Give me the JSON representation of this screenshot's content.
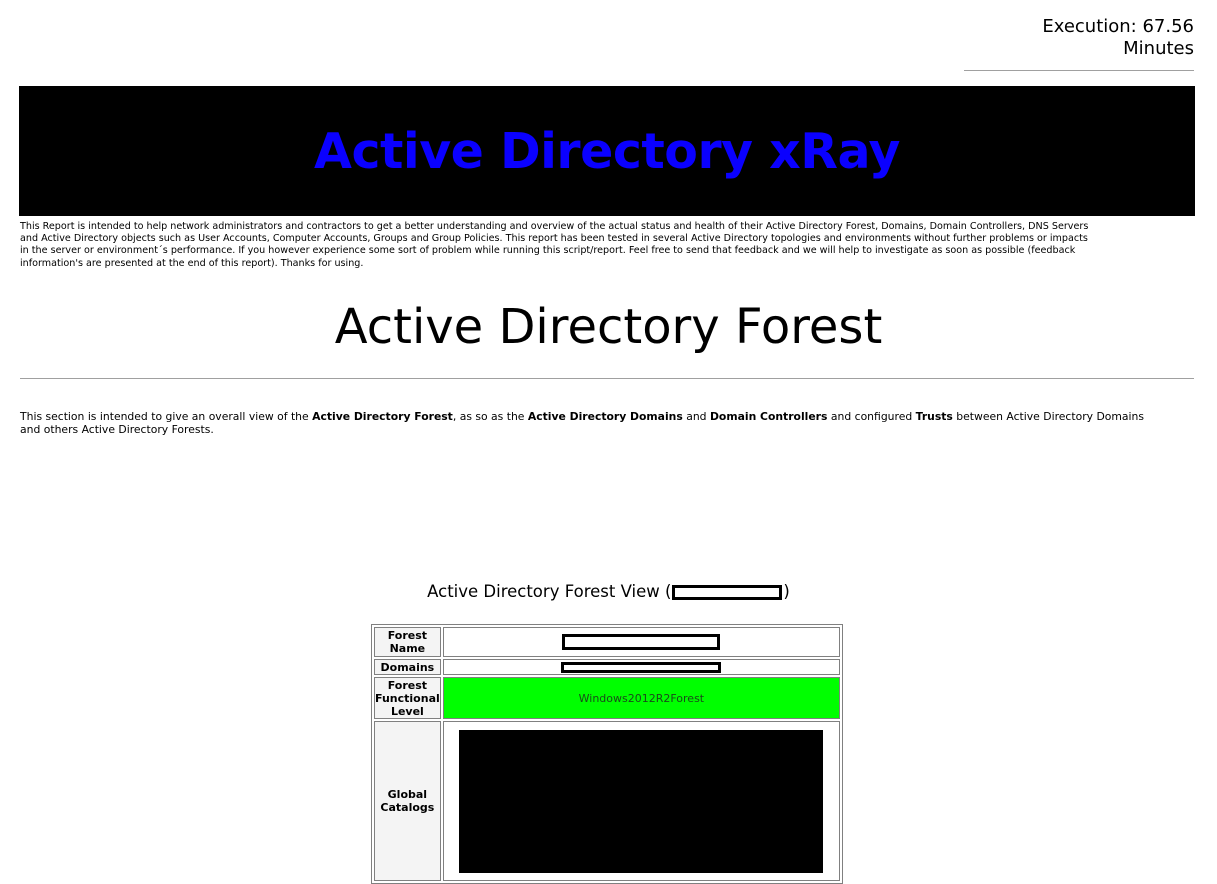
{
  "execution": {
    "line1": "Execution: 67.56",
    "line2": "Minutes"
  },
  "banner": {
    "title": "Active Directory xRay",
    "title_color": "#0a00ff",
    "background": "#000000"
  },
  "intro_text": "This Report is intended to help network administrators and contractors to get a better understanding and overview of the actual status and health of their Active Directory Forest, Domains, Domain Controllers, DNS Servers and Active Directory objects such as User Accounts, Computer Accounts, Groups and Group Policies. This report has been tested in several Active Directory topologies and environments without further problems or impacts in the server or environment´s performance. If you however experience some sort of problem while running this script/report. Feel free to send that feedback and we will help to investigate as soon as possible (feedback information's are presented at the end of this report). Thanks for using.",
  "section": {
    "title": "Active Directory Forest",
    "desc": {
      "p1": "This section is intended to give an overall view of the ",
      "b1": "Active Directory Forest",
      "p2": ", as so as the ",
      "b2": "Active Directory Domains",
      "p3": " and ",
      "b3": "Domain Controllers",
      "p4": " and configured ",
      "b4": "Trusts",
      "p5": " between Active Directory Domains and others Active Directory Forests."
    }
  },
  "forest_view": {
    "title_prefix": "Active Directory Forest View (",
    "title_suffix": ")",
    "rows": {
      "forest_name": {
        "label": "Forest Name"
      },
      "domains": {
        "label": "Domains"
      },
      "functional_level": {
        "label": "Forest Functional Level",
        "value": "Windows2012R2Forest",
        "status_color": "#00ff00"
      },
      "global_catalogs": {
        "label": "Global Catalogs"
      }
    }
  }
}
